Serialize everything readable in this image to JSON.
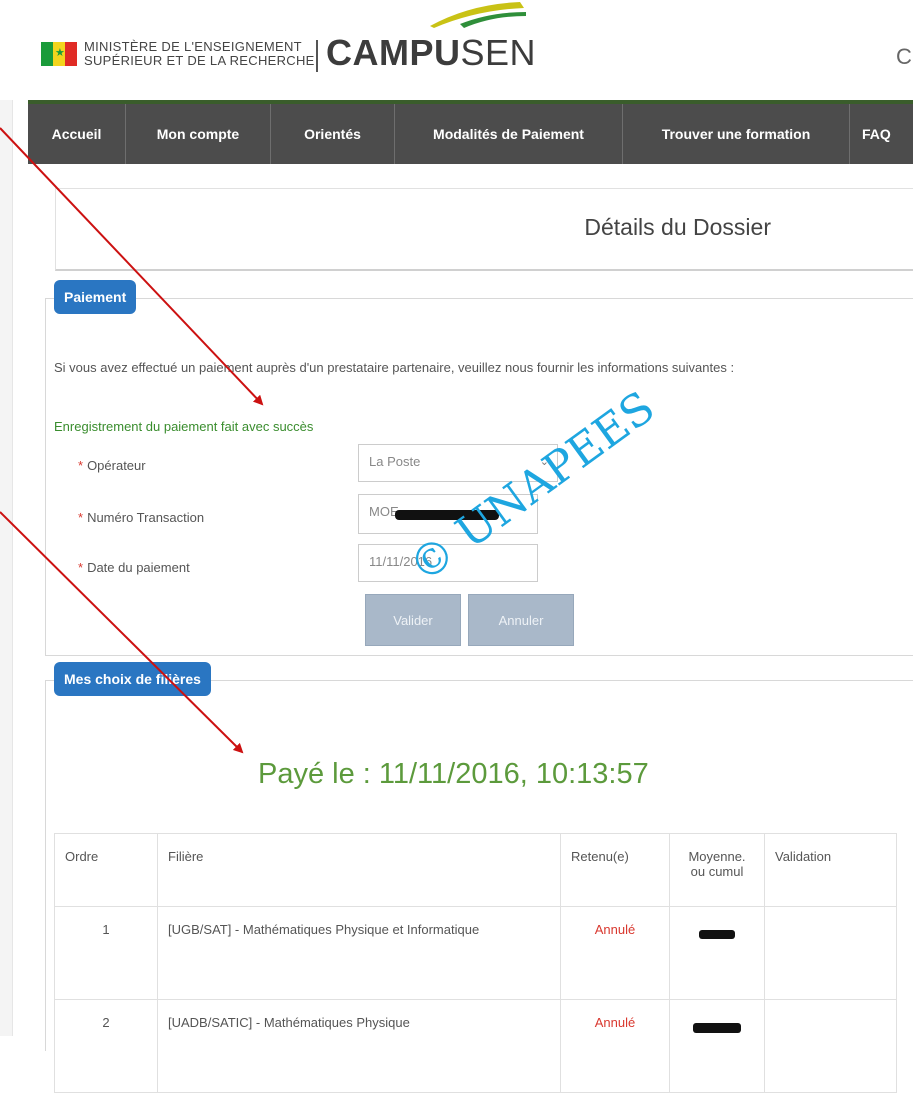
{
  "header": {
    "ministry_line1": "MINISTÈRE DE L'ENSEIGNEMENT",
    "ministry_line2": "SUPÉRIEUR ET DE LA RECHERCHE",
    "logo_bold": "CAMPU",
    "logo_thin": "SEN",
    "right_cut": "C",
    "colors": {
      "flag_green": "#1a9b3a",
      "flag_yellow": "#f3d51d",
      "flag_red": "#e02b25"
    }
  },
  "nav": {
    "items": [
      {
        "label": "Accueil"
      },
      {
        "label": "Mon compte"
      },
      {
        "label": "Orientés"
      },
      {
        "label": "Modalités de Paiement"
      },
      {
        "label": "Trouver une formation"
      },
      {
        "label": "FAQ"
      }
    ],
    "bg_color": "#4c4c4c"
  },
  "page_title": "Détails du Dossier",
  "paiement": {
    "tag": "Paiement",
    "info": "Si vous avez effectué un paiement auprès d'un prestataire partenaire, veuillez nous fournir les informations suivantes :",
    "success": "Enregistrement du paiement fait avec succès",
    "required_mark": "*",
    "fields": {
      "operateur": {
        "label": "Opérateur",
        "value": "La Poste"
      },
      "transaction": {
        "label": "Numéro Transaction",
        "value": "MOE"
      },
      "date": {
        "label": "Date du paiement",
        "value": "11/11/2016"
      }
    },
    "buttons": {
      "valider": "Valider",
      "annuler": "Annuler"
    }
  },
  "watermark": "© UNAPEES",
  "choix": {
    "tag": "Mes choix de filières",
    "paid_text": "Payé le : 11/11/2016, 10:13:57",
    "columns": [
      "Ordre",
      "Filière",
      "Retenu(e)",
      "Moyenne. ou cumul",
      "Validation"
    ],
    "rows": [
      {
        "ordre": "1",
        "filiere": "[UGB/SAT] - Mathématiques Physique et Informatique",
        "retenu": "Annulé"
      },
      {
        "ordre": "2",
        "filiere": "[UADB/SATIC] - Mathématiques Physique",
        "retenu": "Annulé"
      }
    ]
  },
  "colors": {
    "tag_blue": "#2a76c2",
    "success_green": "#3a8d2e",
    "paid_green": "#5c9a3c",
    "annule_red": "#d9382f",
    "watermark_blue": "#1ea6e0",
    "arrow_red": "#cc1111"
  }
}
